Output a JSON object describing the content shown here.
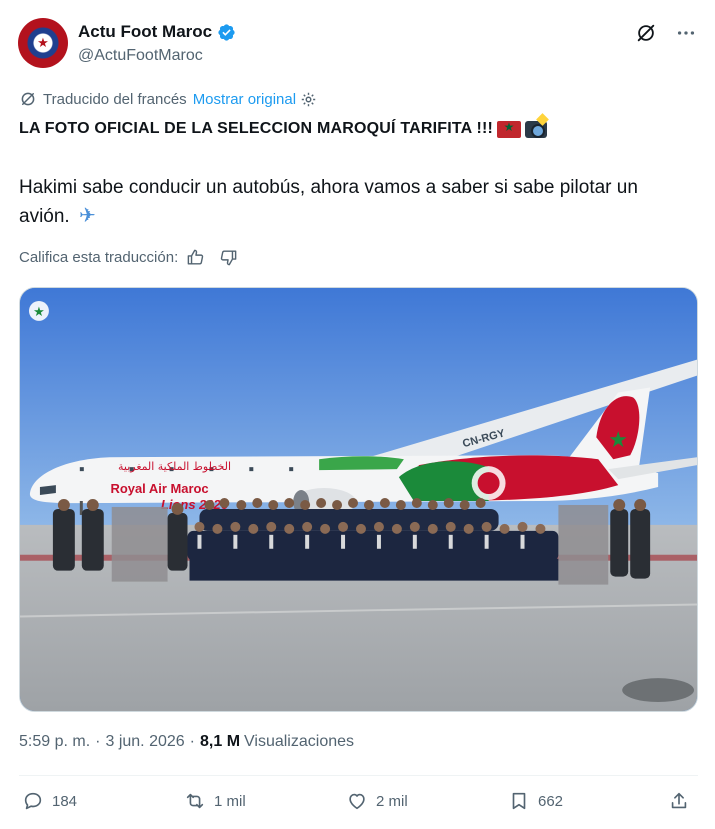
{
  "author": {
    "display_name": "Actu Foot Maroc",
    "handle": "@ActuFootMaroc",
    "verified": true,
    "avatar_icon": "moroccan-federation-crest"
  },
  "header_icons": [
    "grok-icon",
    "more-options-icon"
  ],
  "translation": {
    "label": "Traducido del francés",
    "show_original": "Mostrar original",
    "rate_label": "Califica esta traducción:"
  },
  "tweet": {
    "headline": "LA FOTO OFICIAL DE LA SELECCION MAROQUÍ TARIFITA !!!",
    "body": "Hakimi sabe conducir un autobús, ahora vamos a saber si sabe pilotar un avión."
  },
  "photo": {
    "aircraft_registration": "CN-RGY",
    "airline_arabic": "الخطوط الملكية المغربية",
    "airline_name": "Royal Air Maroc",
    "livery_text": "Lions 2026",
    "fuselage_lettering": "CN-RGY"
  },
  "meta": {
    "time": "5:59 p. m.",
    "separator": "·",
    "date": "3 jun. 2026",
    "views_count": "8,1 M",
    "views_label": "Visualizaciones"
  },
  "actions": {
    "replies": "184",
    "reposts": "1 mil",
    "likes": "2 mil",
    "bookmarks": "662"
  },
  "colors": {
    "link": "#1d9bf0",
    "muted": "#536471",
    "text": "#0f1419",
    "verified": "#1d9bf0",
    "livery_red": "#c8102e",
    "livery_green": "#1b8a3a"
  }
}
